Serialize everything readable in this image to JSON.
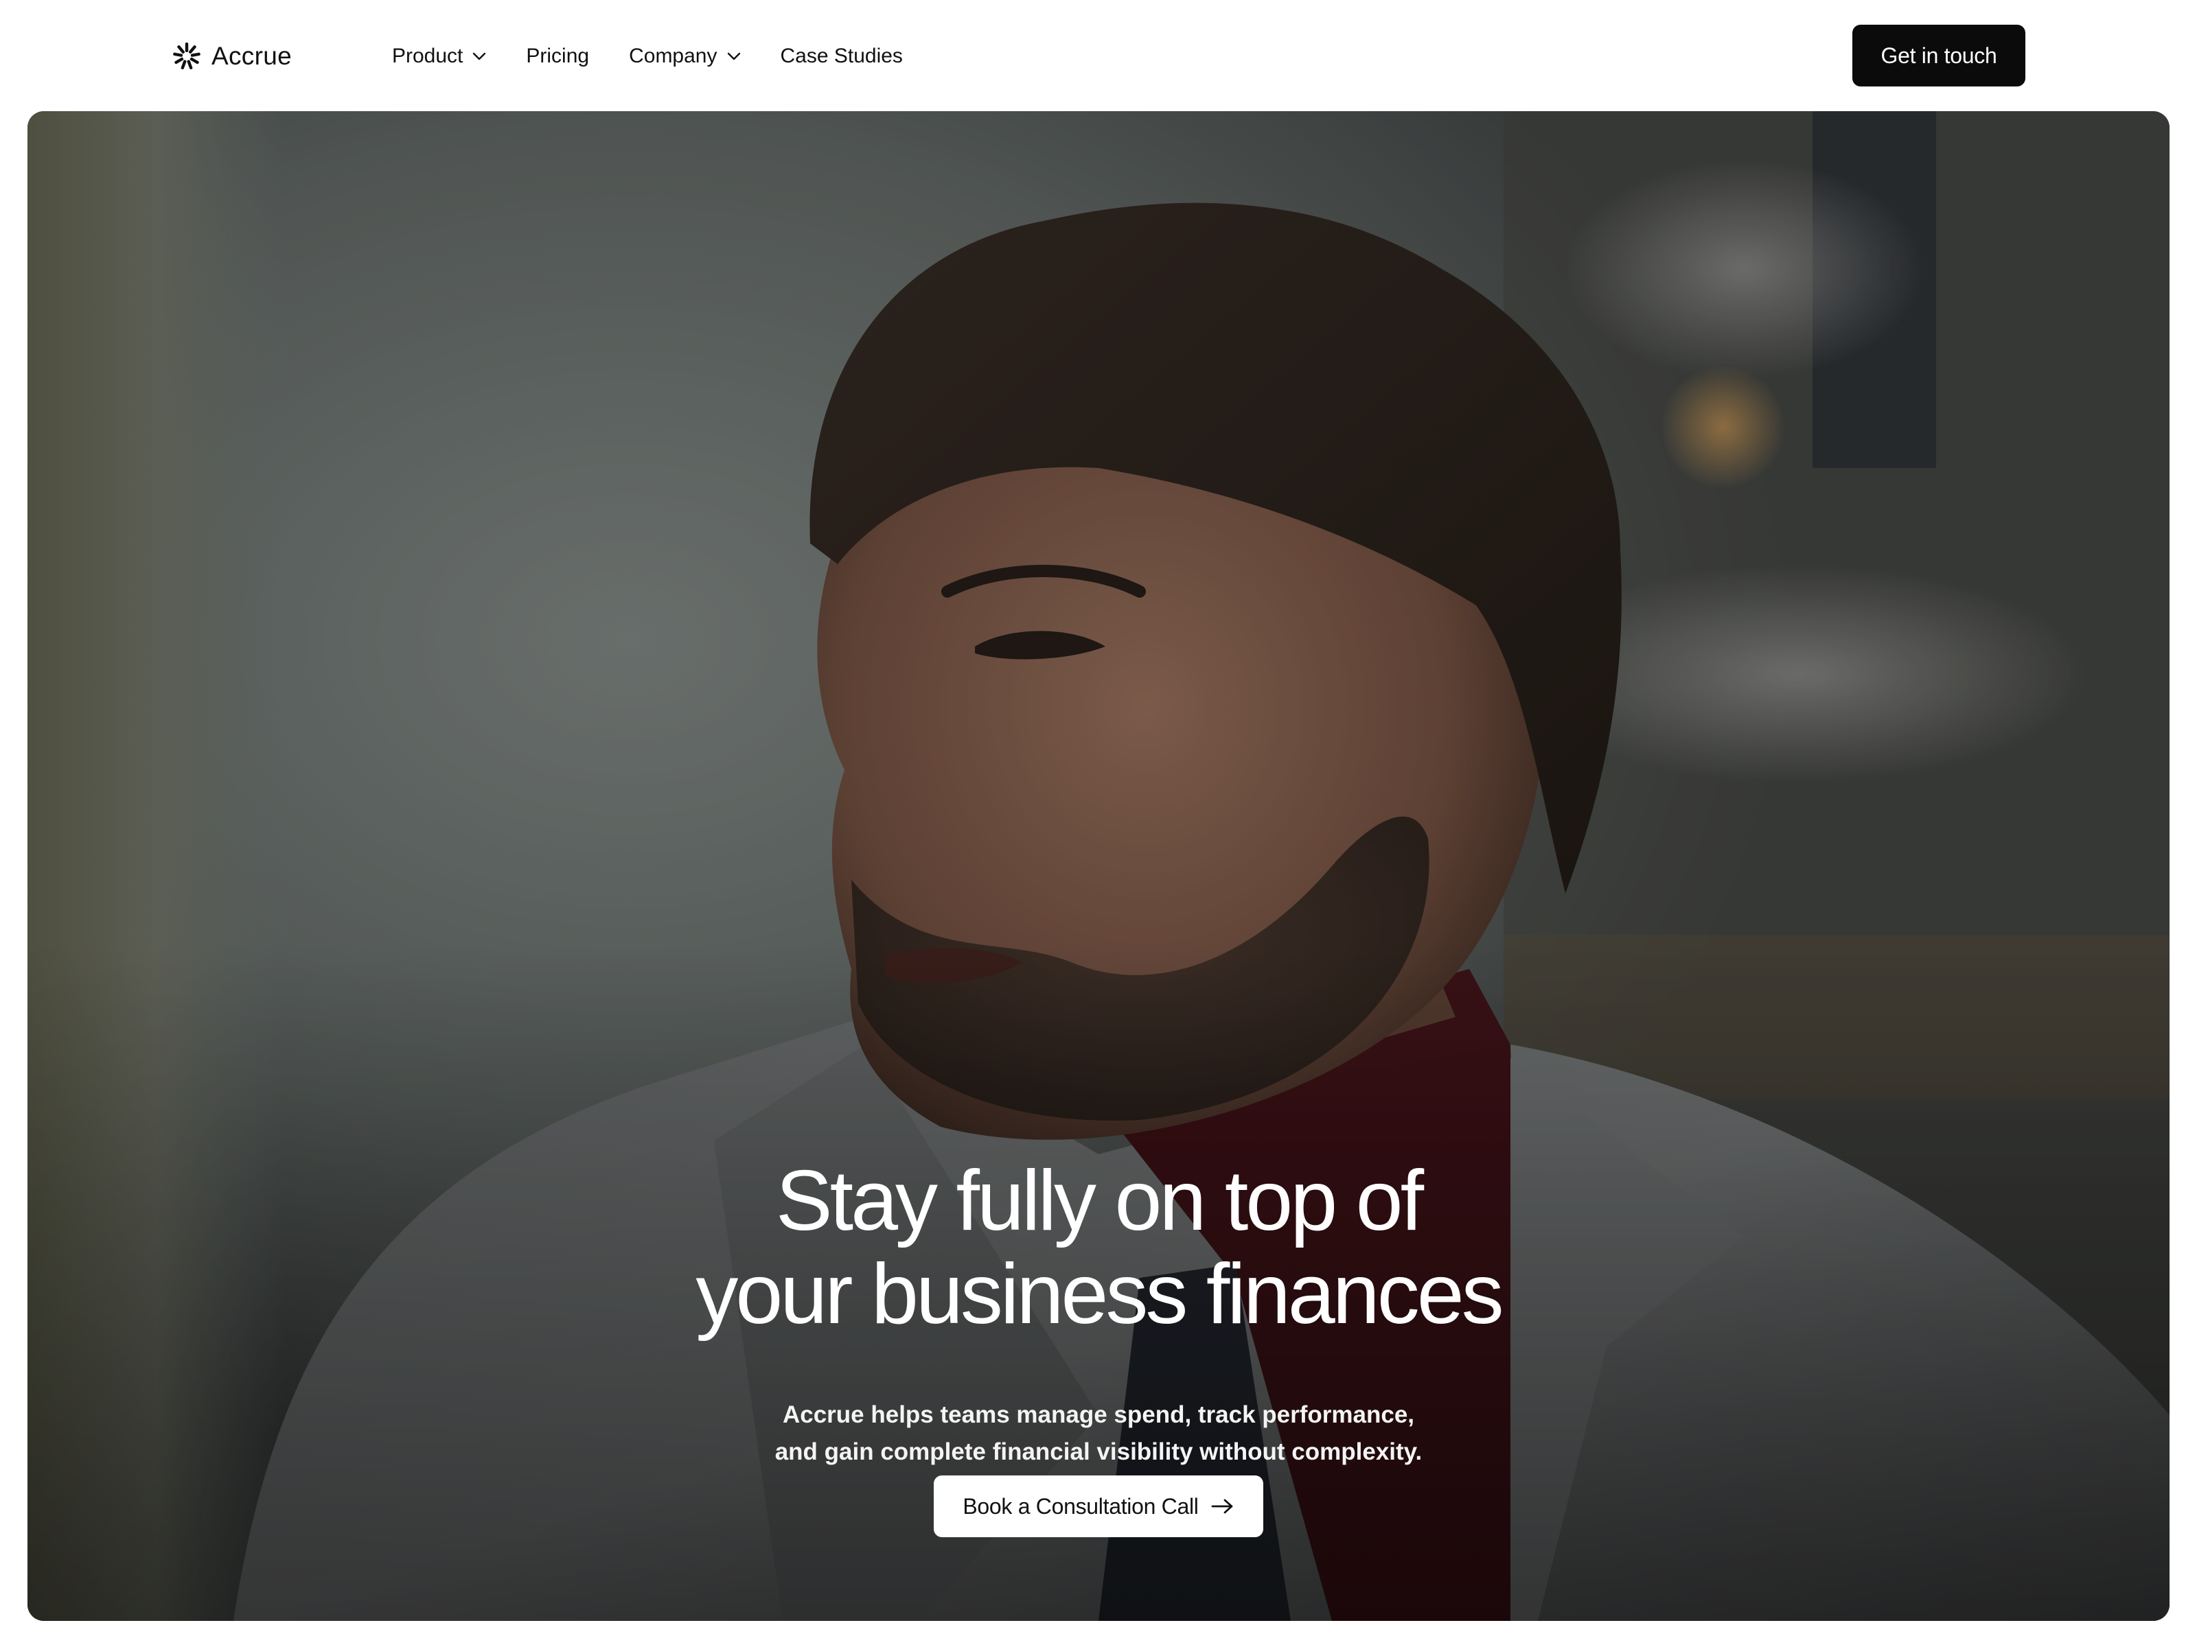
{
  "brand": {
    "name": "Accrue",
    "logo_icon": "asterisk-burst-icon"
  },
  "nav": {
    "items": [
      {
        "label": "Product",
        "has_dropdown": true
      },
      {
        "label": "Pricing",
        "has_dropdown": false
      },
      {
        "label": "Company",
        "has_dropdown": true
      },
      {
        "label": "Case Studies",
        "has_dropdown": false
      }
    ],
    "dropdown_icon": "chevron-down-icon"
  },
  "header": {
    "cta_label": "Get in touch"
  },
  "hero": {
    "title_lines": [
      "Stay fully on top of",
      "your business finances"
    ],
    "subtitle_lines": [
      "Accrue helps teams manage spend, track performance,",
      "and gain complete financial visibility without complexity."
    ],
    "cta_label": "Book a Consultation Call",
    "cta_icon": "arrow-right-icon"
  },
  "colors": {
    "accent_button": "#0b0b0b",
    "page_background": "#ffffff",
    "hero_text": "#ffffff"
  }
}
